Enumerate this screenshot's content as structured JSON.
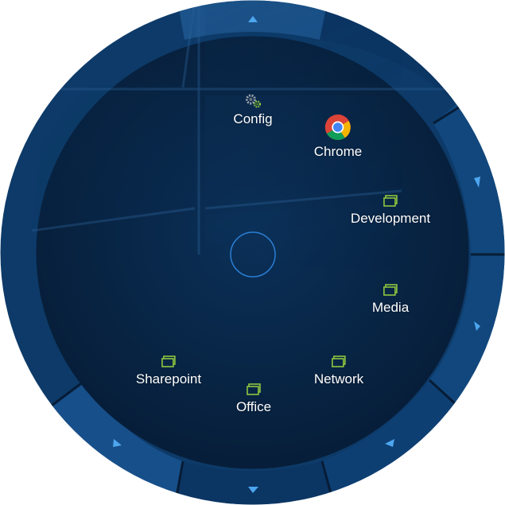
{
  "colors": {
    "ring_outer": "#0d3a68",
    "ring_inner": "#0b315b",
    "inner_disc": "#082544",
    "arrow": "#4da6ee",
    "folder_icon": "#8dc63f",
    "label": "#ffffff",
    "center_ring": "#2b7fd4"
  },
  "items": [
    {
      "id": "config",
      "label": "Config",
      "icon": "gear-icon"
    },
    {
      "id": "chrome",
      "label": "Chrome",
      "icon": "chrome-icon"
    },
    {
      "id": "development",
      "label": "Development",
      "icon": "folder-icon"
    },
    {
      "id": "media",
      "label": "Media",
      "icon": "folder-icon"
    },
    {
      "id": "network",
      "label": "Network",
      "icon": "folder-icon"
    },
    {
      "id": "office",
      "label": "Office",
      "icon": "folder-icon"
    },
    {
      "id": "sharepoint",
      "label": "Sharepoint",
      "icon": "folder-icon"
    }
  ],
  "ring_arrows": [
    {
      "direction": "up",
      "icon": "arrow-up-icon"
    },
    {
      "direction": "right",
      "icon": "arrow-right-icon"
    },
    {
      "direction": "right",
      "icon": "arrow-right-icon"
    },
    {
      "direction": "down-left",
      "icon": "arrow-down-left-icon"
    },
    {
      "direction": "down",
      "icon": "arrow-down-icon"
    },
    {
      "direction": "down-left",
      "icon": "arrow-down-left-icon"
    }
  ],
  "center": {
    "icon": "center-ring-icon"
  }
}
